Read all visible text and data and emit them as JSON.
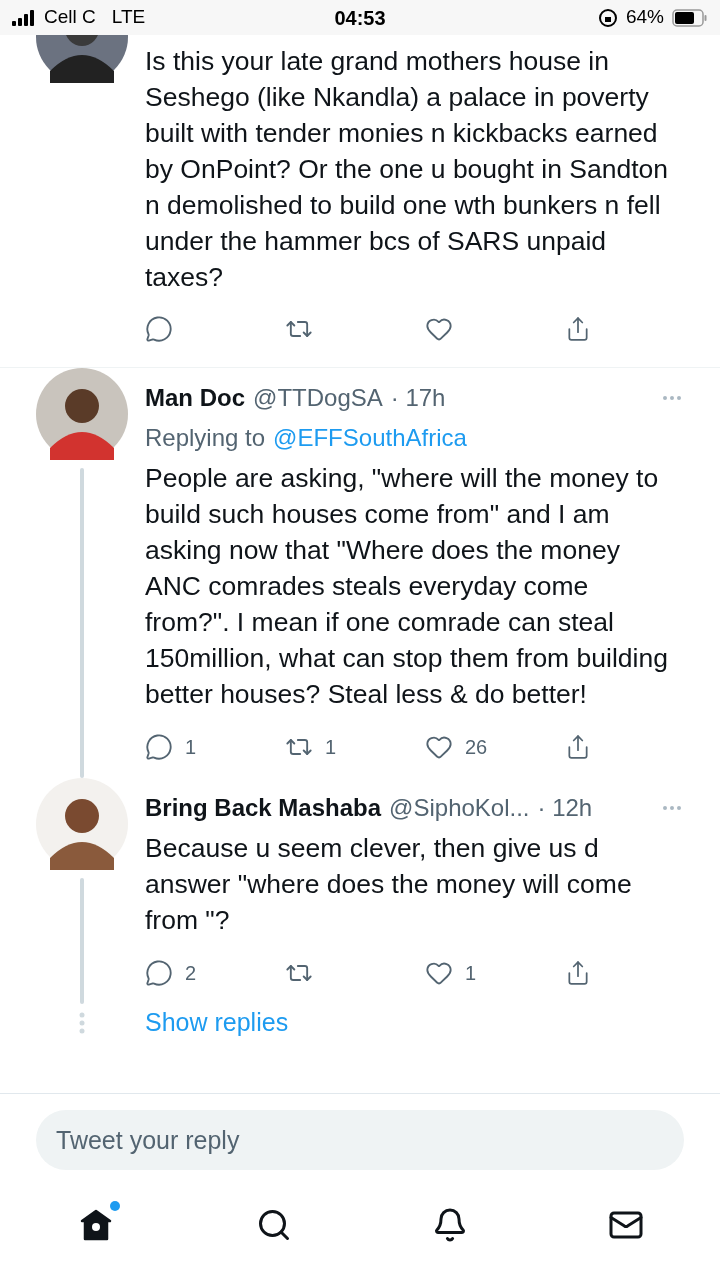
{
  "status_bar": {
    "carrier": "Cell C",
    "network": "LTE",
    "time": "04:53",
    "battery": "64%"
  },
  "tweets": [
    {
      "text": "Is this your late grand mothers house in Seshego (like Nkandla) a palace in poverty built with tender monies n kickbacks earned by OnPoint? Or the one u bought in Sandton n demolished to build one wth bunkers n fell under the hammer bcs of SARS unpaid taxes?",
      "thread_line": false,
      "divider": true
    },
    {
      "author": "Man Doc",
      "handle": "@TTDogSA",
      "time": "· 17h",
      "replying_label": "Replying to",
      "replying_to": "@EFFSouthAfrica",
      "text": "People are asking, \"where will the money to build such houses come from\" and I am asking now that \"Where does the money ANC comrades steals everyday come from?\". I mean if one comrade can steal 150million, what can stop them from building better houses? Steal less & do better!",
      "thread_line": true,
      "actions": {
        "replies": "1",
        "retweets": "1",
        "likes": "26"
      },
      "divider": false
    },
    {
      "author": "Bring Back Mashaba",
      "handle": "@SiphoKol...",
      "time": "· 12h",
      "text": "Because u seem clever, then give us d answer \"where does the money will come from \"?",
      "thread_line": true,
      "actions": {
        "replies": "2",
        "likes": "1"
      },
      "divider": false
    }
  ],
  "show_replies": "Show replies",
  "reply_field": {
    "placeholder": "Tweet your reply"
  },
  "nav": [
    {
      "kind": "home",
      "selected": true,
      "badge": true
    },
    {
      "kind": "search",
      "selected": false,
      "badge": false
    },
    {
      "kind": "notifications",
      "selected": false,
      "badge": false
    },
    {
      "kind": "messages",
      "selected": false,
      "badge": false
    }
  ]
}
